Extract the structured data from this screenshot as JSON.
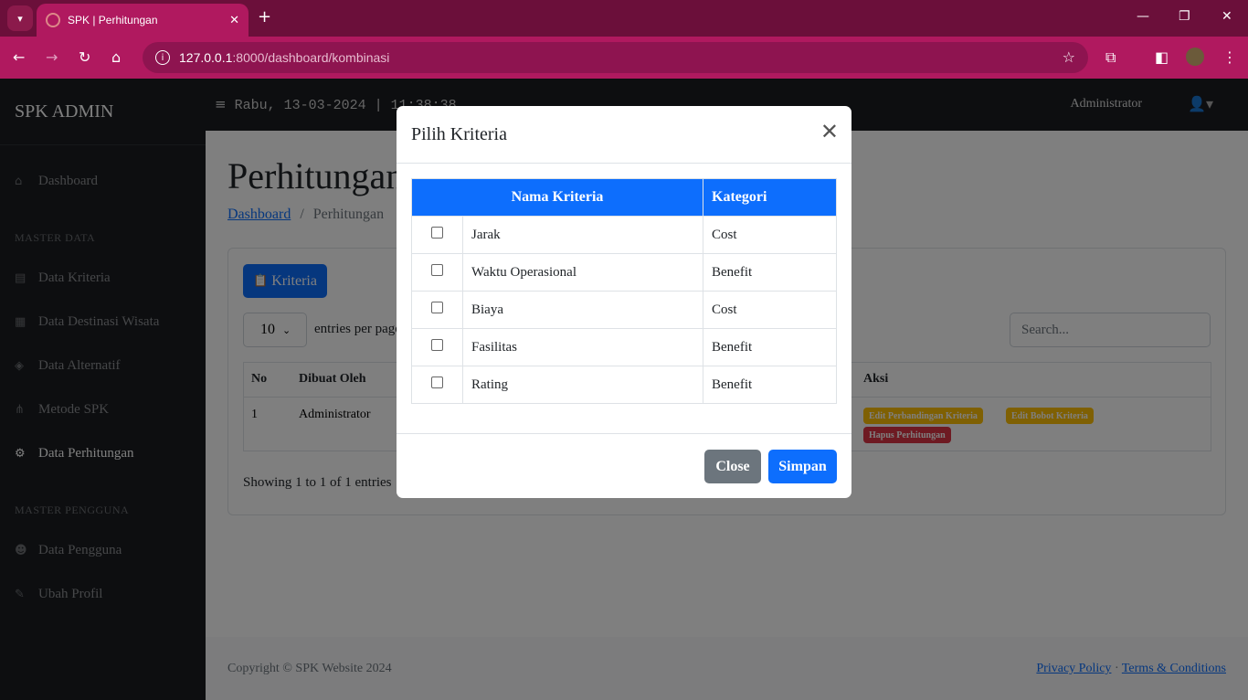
{
  "browser": {
    "tab_title": "SPK | Perhitungan",
    "url_host": "127.0.0.1",
    "url_rest": ":8000/dashboard/kombinasi"
  },
  "app": {
    "brand": "SPK ADMIN",
    "clock": "Rabu, 13-03-2024 | 11:38:38",
    "user": "Administrator"
  },
  "sidebar": {
    "items": [
      {
        "label": "Dashboard"
      },
      {
        "label": "Data Kriteria"
      },
      {
        "label": "Data Destinasi Wisata"
      },
      {
        "label": "Data Alternatif"
      },
      {
        "label": "Metode SPK"
      },
      {
        "label": "Data Perhitungan"
      },
      {
        "label": "Data Pengguna"
      },
      {
        "label": "Ubah Profil"
      }
    ],
    "section_master_data": "MASTER DATA",
    "section_master_pengguna": "MASTER PENGGUNA"
  },
  "main": {
    "title": "Perhitungan",
    "breadcrumb_link": "Dashboard",
    "breadcrumb_sep": "/",
    "breadcrumb_current": "Perhitungan",
    "kriteria_button": "Kriteria",
    "entries_value": "10",
    "entries_label": "entries per page",
    "search_placeholder": "Search...",
    "table_headers": {
      "no": "No",
      "dibuat_oleh": "Dibuat Oleh",
      "aksi": "Aksi"
    },
    "row": {
      "no": "1",
      "dibuat_oleh": "Administrator"
    },
    "actions": {
      "edit_perbandingan": "Edit Perbandingan Kriteria",
      "edit_bobot": "Edit Bobot Kriteria",
      "hapus": "Hapus Perhitungan"
    },
    "showing": "Showing 1 to 1 of 1 entries"
  },
  "footer": {
    "copyright": "Copyright © SPK Website 2024",
    "privacy": "Privacy Policy",
    "dot": "·",
    "terms": "Terms & Conditions"
  },
  "modal": {
    "title": "Pilih Kriteria",
    "col_nama": "Nama Kriteria",
    "col_kategori": "Kategori",
    "rows": [
      {
        "nama": "Jarak",
        "kategori": "Cost"
      },
      {
        "nama": "Waktu Operasional",
        "kategori": "Benefit"
      },
      {
        "nama": "Biaya",
        "kategori": "Cost"
      },
      {
        "nama": "Fasilitas",
        "kategori": "Benefit"
      },
      {
        "nama": "Rating",
        "kategori": "Benefit"
      }
    ],
    "close_label": "Close",
    "save_label": "Simpan"
  },
  "colors": {
    "browser_chrome": "#b0195f",
    "primary": "#0d6efd",
    "secondary": "#6c757d",
    "sidebar": "#1a1d21"
  }
}
